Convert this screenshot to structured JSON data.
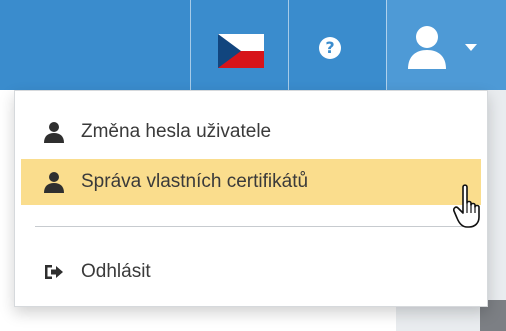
{
  "header": {
    "language_icon": "czech-flag-icon",
    "help_icon": "help-icon",
    "user_icon": "user-icon",
    "user_menu_icon": "chevron-down-icon",
    "bar_color": "#3a8ccd"
  },
  "user_menu": {
    "items": [
      {
        "label": "Změna hesla uživatele",
        "icon": "user-icon",
        "active": false
      },
      {
        "label": "Správa vlastních certifikátů",
        "icon": "user-icon",
        "active": true
      },
      {
        "label": "Odhlásit",
        "icon": "sign-out-icon",
        "active": false
      }
    ],
    "highlight_color": "#fadd8d"
  },
  "cursor": {
    "icon": "hand-pointer-icon"
  }
}
